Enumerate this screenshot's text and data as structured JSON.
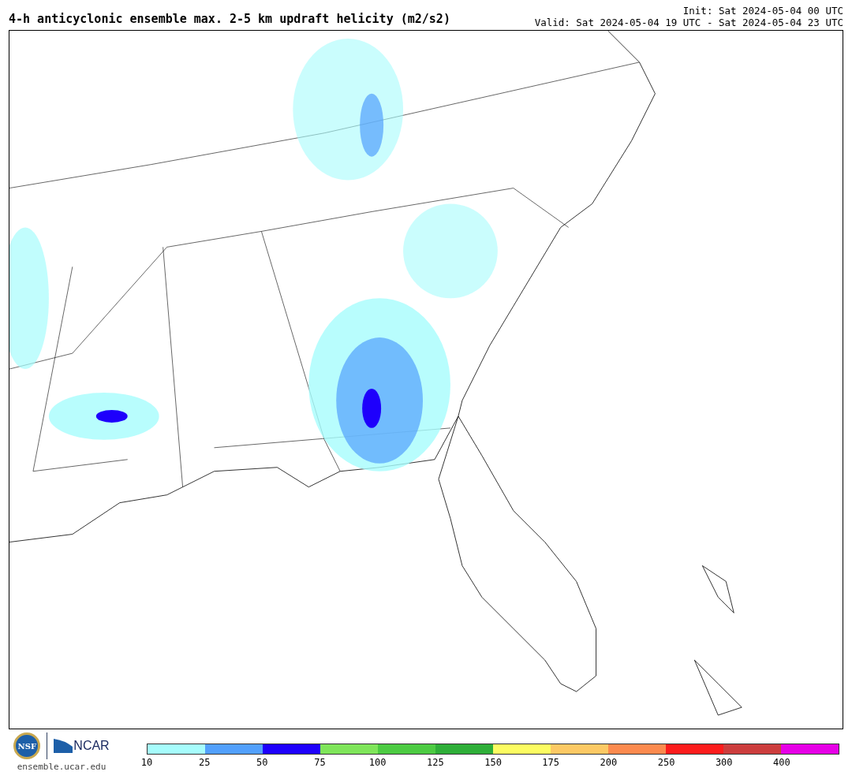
{
  "title": "4-h anticyclonic ensemble max. 2-5 km updraft helicity (m2/s2)",
  "init": "Init: Sat 2024-05-04 00 UTC",
  "valid": "Valid: Sat 2024-05-04 19 UTC - Sat 2024-05-04 23 UTC",
  "logos": {
    "nsf": "NSF",
    "ncar": "NCAR",
    "site": "ensemble.ucar.edu"
  },
  "colorbar": [
    {
      "label": "10",
      "color": "#a6fcfc"
    },
    {
      "label": "25",
      "color": "#52a0fc"
    },
    {
      "label": "50",
      "color": "#1e00fc"
    },
    {
      "label": "75",
      "color": "#7fe55a"
    },
    {
      "label": "100",
      "color": "#4ccb42"
    },
    {
      "label": "125",
      "color": "#2eae38"
    },
    {
      "label": "150",
      "color": "#fcfc61"
    },
    {
      "label": "175",
      "color": "#fcc964"
    },
    {
      "label": "200",
      "color": "#fc8a4e"
    },
    {
      "label": "250",
      "color": "#fc1c1c"
    },
    {
      "label": "300",
      "color": "#cc3d3d"
    },
    {
      "label": "400",
      "color": "#e600e6"
    }
  ]
}
